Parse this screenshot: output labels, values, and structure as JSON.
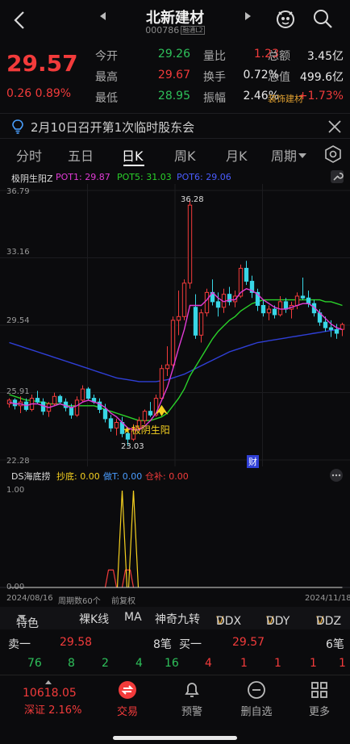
{
  "header": {
    "title": "北新建材",
    "code": "000786",
    "code_tags": "融通L2",
    "back_icon": "chevron-left-icon",
    "prev_icon": "triangle-left-icon",
    "next_icon": "triangle-right-icon",
    "mascot_icon": "mascot-icon",
    "search_icon": "search-icon"
  },
  "quote": {
    "price": "29.57",
    "change": "0.26",
    "change_pct": "0.89%",
    "rows": [
      {
        "l1": "今开",
        "v1": "29.26",
        "v1c": "green",
        "l2": "量比",
        "v2": "1.23",
        "v2c": "red",
        "l3": "总额",
        "v3": "3.45亿",
        "v3c": "white"
      },
      {
        "l1": "最高",
        "v1": "29.67",
        "v1c": "red",
        "l2": "换手",
        "v2": "0.72%",
        "v2c": "white",
        "l3": "总值",
        "v3": "499.6亿",
        "v3c": "white"
      },
      {
        "l1": "最低",
        "v1": "28.95",
        "v1c": "green",
        "l2": "振幅",
        "v2": "2.46%",
        "v2c": "white",
        "l3": "装饰建材",
        "v3": "+1.73%",
        "v3c": "red"
      }
    ]
  },
  "notice": {
    "text": "2月10日召开第1次临时股东会",
    "icon": "lightbulb-icon",
    "close_icon": "close-icon"
  },
  "period_tabs": [
    "分时",
    "五日",
    "日K",
    "周K",
    "月K",
    "周期"
  ],
  "active_tab": "日K",
  "ma_legend": {
    "name": "极阴生阳Z",
    "pot1": "POT1: 29.87",
    "pot5": "POT5: 31.03",
    "pot6": "POT6: 29.06"
  },
  "chart_axis": {
    "y_ticks": [
      "36.79",
      "33.16",
      "29.54",
      "25.91",
      "22.28"
    ],
    "max_label": "36.28",
    "min_label": "23.03",
    "signal_label": "极阴生阳",
    "event_marker": "财"
  },
  "indicator": {
    "name": "DS海底捞",
    "chaodi": "抄底: 0.00",
    "zuot": "做T: 0.00",
    "cangbu": "仓补: 0.00",
    "y_top": "1.00",
    "y_bottom": "0.00"
  },
  "date_row": {
    "start": "2024/08/16",
    "period_count": "周期数60个",
    "adjust": "前复权",
    "end": "2024/11/18"
  },
  "indicator_tabs": [
    "特色",
    "裸K线",
    "MA",
    "神奇九转",
    "DDX",
    "DDY",
    "DDZ"
  ],
  "order_book": {
    "sell_label": "卖一",
    "sell_price": "29.58",
    "sell_count": "8笔",
    "buy_label": "买一",
    "buy_price": "29.57",
    "buy_count": "6笔"
  },
  "trades": [
    "76",
    "8",
    "2",
    "4",
    "16",
    "4",
    "1",
    "1",
    "1",
    "1"
  ],
  "bottom": {
    "index_value": "10618.05",
    "index_name": "深证 2.16%",
    "nav": [
      "交易",
      "预警",
      "删自选",
      "更多"
    ]
  },
  "colors": {
    "up": "#f23b3b",
    "down": "#2ec05a",
    "ma_magenta": "#e23bd6",
    "ma_green": "#2ad12a",
    "ma_blue": "#2f3fd6",
    "signal_yellow": "#f5d020"
  },
  "chart_data": {
    "type": "candlestick",
    "y_range": [
      22.28,
      36.79
    ],
    "candles": [
      [
        25.3,
        25.6,
        25.1,
        25.5
      ],
      [
        25.5,
        25.6,
        25.0,
        25.2
      ],
      [
        25.2,
        25.7,
        24.8,
        25.4
      ],
      [
        25.4,
        25.6,
        24.9,
        25.0
      ],
      [
        25.0,
        25.8,
        24.9,
        25.6
      ],
      [
        25.6,
        26.0,
        25.3,
        25.4
      ],
      [
        25.4,
        25.6,
        24.7,
        24.9
      ],
      [
        24.9,
        25.4,
        24.6,
        25.3
      ],
      [
        25.3,
        25.9,
        25.2,
        25.7
      ],
      [
        25.7,
        25.8,
        25.3,
        25.4
      ],
      [
        25.4,
        25.6,
        24.9,
        25.1
      ],
      [
        25.1,
        25.3,
        24.5,
        24.7
      ],
      [
        24.7,
        25.7,
        24.6,
        25.5
      ],
      [
        25.5,
        26.3,
        25.4,
        26.1
      ],
      [
        26.1,
        26.2,
        25.5,
        25.6
      ],
      [
        25.6,
        25.8,
        25.3,
        25.4
      ],
      [
        25.4,
        25.6,
        24.8,
        25.0
      ],
      [
        25.0,
        25.3,
        24.3,
        24.5
      ],
      [
        24.5,
        24.7,
        23.8,
        24.0
      ],
      [
        24.0,
        24.5,
        23.6,
        24.3
      ],
      [
        24.3,
        24.6,
        23.5,
        23.7
      ],
      [
        23.7,
        24.0,
        23.03,
        23.4
      ],
      [
        23.4,
        24.2,
        23.3,
        24.0
      ],
      [
        24.0,
        24.6,
        23.8,
        24.4
      ],
      [
        24.4,
        25.0,
        24.2,
        24.9
      ],
      [
        24.9,
        25.4,
        24.6,
        24.7
      ],
      [
        24.7,
        25.8,
        24.6,
        25.6
      ],
      [
        25.6,
        27.4,
        25.5,
        27.2
      ],
      [
        27.2,
        28.4,
        26.8,
        27.4
      ],
      [
        27.4,
        30.0,
        27.2,
        29.8
      ],
      [
        29.8,
        31.4,
        29.0,
        30.0
      ],
      [
        30.0,
        32.0,
        29.8,
        31.8
      ],
      [
        31.8,
        36.28,
        31.5,
        36.0
      ],
      [
        30.5,
        31.2,
        28.8,
        29.0
      ],
      [
        29.0,
        30.4,
        28.6,
        30.2
      ],
      [
        30.2,
        31.5,
        30.0,
        31.3
      ],
      [
        31.3,
        32.0,
        30.6,
        30.8
      ],
      [
        30.8,
        31.3,
        30.0,
        30.5
      ],
      [
        30.5,
        31.5,
        30.2,
        31.2
      ],
      [
        31.2,
        31.6,
        30.6,
        30.8
      ],
      [
        30.8,
        31.4,
        30.5,
        31.1
      ],
      [
        31.1,
        32.8,
        31.0,
        32.6
      ],
      [
        32.6,
        33.0,
        31.7,
        31.9
      ],
      [
        31.9,
        32.2,
        31.0,
        31.3
      ],
      [
        31.3,
        31.5,
        30.3,
        30.6
      ],
      [
        30.6,
        30.9,
        30.0,
        30.2
      ],
      [
        30.2,
        30.6,
        29.8,
        30.4
      ],
      [
        30.4,
        30.6,
        29.9,
        30.1
      ],
      [
        30.1,
        31.1,
        30.0,
        30.8
      ],
      [
        30.8,
        31.0,
        30.2,
        30.4
      ],
      [
        30.4,
        30.8,
        29.9,
        30.6
      ],
      [
        30.6,
        31.3,
        30.4,
        31.1
      ],
      [
        31.1,
        32.1,
        30.9,
        31.0
      ],
      [
        31.0,
        31.4,
        30.5,
        30.7
      ],
      [
        30.7,
        30.9,
        30.0,
        30.2
      ],
      [
        30.2,
        30.4,
        29.5,
        29.7
      ],
      [
        29.7,
        30.0,
        29.2,
        29.4
      ],
      [
        29.4,
        29.8,
        28.9,
        29.3
      ],
      [
        29.3,
        29.6,
        28.8,
        29.1
      ],
      [
        29.31,
        29.67,
        28.95,
        29.57
      ]
    ],
    "ma_magenta": [
      25.4,
      25.3,
      25.3,
      25.2,
      25.3,
      25.3,
      25.2,
      25.1,
      25.2,
      25.3,
      25.2,
      25.1,
      25.2,
      25.4,
      25.5,
      25.4,
      25.3,
      25.1,
      24.8,
      24.6,
      24.3,
      24.0,
      23.9,
      23.9,
      24.1,
      24.4,
      24.8,
      25.5,
      26.2,
      27.2,
      28.3,
      29.3,
      30.6,
      30.6,
      30.6,
      30.9,
      31.3,
      31.0,
      30.8,
      30.9,
      30.9,
      31.3,
      31.5,
      31.4,
      31.2,
      30.9,
      30.7,
      30.5,
      30.4,
      30.4,
      30.5,
      30.6,
      30.7,
      30.7,
      30.5,
      30.2,
      29.9,
      29.6,
      29.4,
      29.3
    ],
    "ma_green": [
      25.8,
      25.7,
      25.6,
      25.5,
      25.5,
      25.4,
      25.4,
      25.3,
      25.3,
      25.3,
      25.2,
      25.2,
      25.2,
      25.2,
      25.2,
      25.2,
      25.1,
      25.0,
      24.9,
      24.8,
      24.7,
      24.6,
      24.5,
      24.4,
      24.4,
      24.4,
      24.5,
      24.6,
      24.8,
      25.2,
      25.6,
      26.1,
      26.8,
      27.3,
      27.8,
      28.3,
      28.8,
      29.2,
      29.5,
      29.8,
      30.0,
      30.3,
      30.5,
      30.7,
      30.8,
      30.9,
      30.9,
      30.9,
      30.9,
      30.9,
      30.9,
      30.9,
      30.9,
      30.9,
      30.9,
      30.9,
      30.8,
      30.8,
      30.7,
      30.6
    ],
    "ma_blue": [
      28.6,
      28.5,
      28.4,
      28.3,
      28.2,
      28.1,
      28.0,
      27.9,
      27.8,
      27.7,
      27.6,
      27.5,
      27.4,
      27.3,
      27.2,
      27.1,
      27.0,
      26.9,
      26.8,
      26.7,
      26.65,
      26.6,
      26.55,
      26.5,
      26.5,
      26.5,
      26.5,
      26.55,
      26.6,
      26.7,
      26.8,
      26.9,
      27.05,
      27.2,
      27.35,
      27.5,
      27.65,
      27.8,
      27.95,
      28.1,
      28.2,
      28.3,
      28.4,
      28.5,
      28.6,
      28.65,
      28.7,
      28.75,
      28.8,
      28.85,
      28.9,
      28.95,
      29.0,
      29.05,
      29.1,
      29.15,
      29.2,
      29.25,
      29.3,
      29.35
    ],
    "indicator": [
      0,
      0,
      0,
      0,
      0,
      0,
      0,
      0,
      0,
      0,
      0,
      0,
      0,
      0,
      0,
      0,
      0,
      0,
      0,
      0,
      0,
      0,
      0,
      0,
      0,
      0,
      0,
      0,
      0,
      0,
      0,
      0,
      0,
      0,
      0,
      0,
      0,
      0,
      0,
      0,
      0,
      0,
      0,
      0,
      0,
      0,
      0,
      0,
      0,
      0,
      0,
      0,
      0,
      0,
      0,
      0,
      0,
      0,
      0,
      0
    ],
    "indicator_spikes": [
      {
        "index": 20,
        "value": 1.0
      },
      {
        "index": 22,
        "value": 1.0
      }
    ],
    "indicator_bumps": [
      {
        "from": 17,
        "to": 19,
        "value": 0.18
      },
      {
        "from": 20,
        "to": 22,
        "value": 0.18
      }
    ]
  }
}
